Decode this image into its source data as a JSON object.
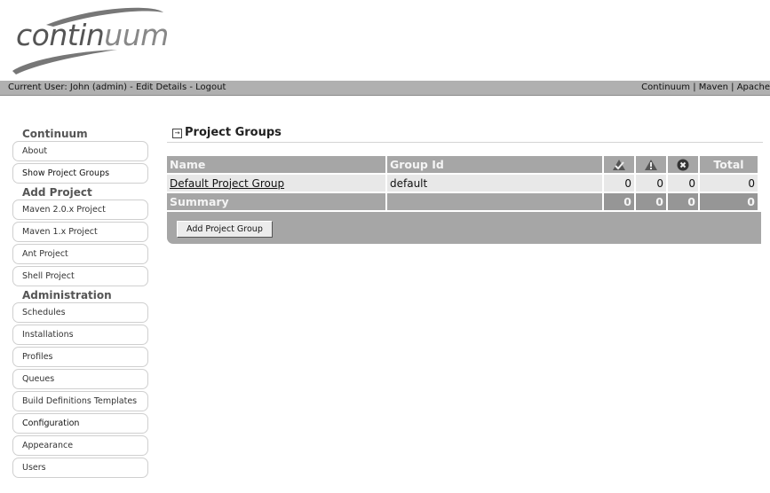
{
  "logo": {
    "text_dark": "contin",
    "text_light": "uum"
  },
  "topbar": {
    "current_user_label": "Current User:",
    "current_user": "John (admin)",
    "sep1": " - ",
    "edit_details": "Edit Details",
    "sep2": " - ",
    "logout": "Logout",
    "links": [
      "Continuum",
      "Maven",
      "Apache"
    ],
    "link_sep": " | "
  },
  "sidebar": {
    "sections": [
      {
        "heading": "Continuum",
        "items": [
          {
            "label": "About",
            "bold": false
          },
          {
            "label": "Show Project Groups",
            "bold": true
          }
        ]
      },
      {
        "heading": "Add Project",
        "items": [
          {
            "label": "Maven 2.0.x Project",
            "bold": false
          },
          {
            "label": "Maven 1.x Project",
            "bold": false
          },
          {
            "label": "Ant Project",
            "bold": false
          },
          {
            "label": "Shell Project",
            "bold": false
          }
        ]
      },
      {
        "heading": "Administration",
        "items": [
          {
            "label": "Schedules",
            "bold": false
          },
          {
            "label": "Installations",
            "bold": false
          },
          {
            "label": "Profiles",
            "bold": false
          },
          {
            "label": "Queues",
            "bold": false
          },
          {
            "label": "Build Definitions Templates",
            "bold": false
          },
          {
            "label": "Configuration",
            "bold": true
          },
          {
            "label": "Appearance",
            "bold": false
          },
          {
            "label": "Users",
            "bold": false
          }
        ]
      }
    ]
  },
  "main": {
    "title": "Project Groups",
    "title_icon": "expand-box-icon",
    "table": {
      "headers": {
        "name": "Name",
        "group_id": "Group Id",
        "success_icon": "success-icon",
        "failure_icon": "warning-icon",
        "error_icon": "error-icon",
        "total": "Total"
      },
      "rows": [
        {
          "name": "Default Project Group",
          "group_id": "default",
          "success": "0",
          "failure": "0",
          "error": "0",
          "total": "0"
        }
      ],
      "summary": {
        "label": "Summary",
        "group_id": "",
        "success": "0",
        "failure": "0",
        "error": "0",
        "total": "0"
      }
    },
    "add_button": "Add Project Group"
  }
}
